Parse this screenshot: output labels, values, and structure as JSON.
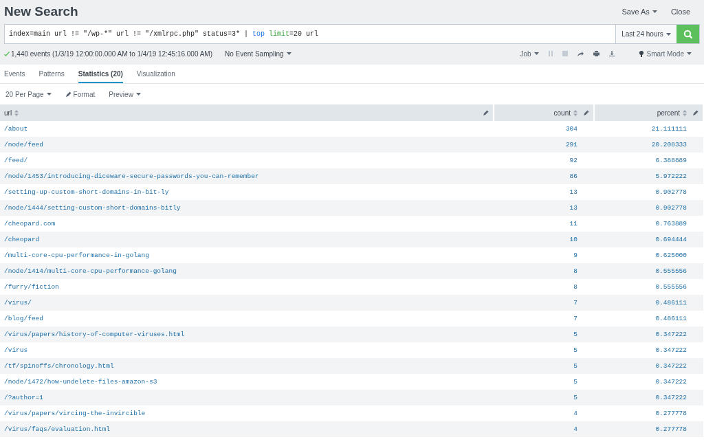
{
  "title": "New Search",
  "header_actions": [
    {
      "label": "Save As",
      "dropdown": true
    },
    {
      "label": "Close",
      "dropdown": false
    }
  ],
  "query": [
    {
      "text": "index=main url != \"/wp-*\" url != \"/xmlrpc.php\" status=3* | ",
      "kind": "plain"
    },
    {
      "text": "top ",
      "kind": "command"
    },
    {
      "text": "limit",
      "kind": "argument"
    },
    {
      "text": "=20 url",
      "kind": "plain"
    }
  ],
  "time_range": "Last 24 hours",
  "status": {
    "summary": "1,440 events (1/3/19 12:00:00.000 AM to 1/4/19 12:45:16.000 AM)",
    "sampling": "No Event Sampling",
    "job": "Job",
    "mode": "Smart Mode"
  },
  "tabs": [
    {
      "label": "Events",
      "selected": false
    },
    {
      "label": "Patterns",
      "selected": false
    },
    {
      "label": "Statistics (20)",
      "selected": true
    },
    {
      "label": "Visualization",
      "selected": false
    }
  ],
  "toolbar": [
    "20 Per Page",
    "Format",
    "Preview"
  ],
  "table": {
    "columns": [
      "url",
      "count",
      "percent"
    ],
    "rows": [
      [
        "/about",
        "304",
        "21.111111"
      ],
      [
        "/node/feed",
        "291",
        "20.208333"
      ],
      [
        "/feed/",
        "92",
        "6.388889"
      ],
      [
        "/node/1453/introducing-diceware-secure-passwords-you-can-remember",
        "86",
        "5.972222"
      ],
      [
        "/setting-up-custom-short-domains-in-bit-ly",
        "13",
        "0.902778"
      ],
      [
        "/node/1444/setting-custom-short-domains-bitly",
        "13",
        "0.902778"
      ],
      [
        "/cheopard.com",
        "11",
        "0.763889"
      ],
      [
        "/cheopard",
        "10",
        "0.694444"
      ],
      [
        "/multi-core-cpu-performance-in-golang",
        "9",
        "0.625000"
      ],
      [
        "/node/1414/multi-core-cpu-performance-golang",
        "8",
        "0.555556"
      ],
      [
        "/furry/fiction",
        "8",
        "0.555556"
      ],
      [
        "/virus/",
        "7",
        "0.486111"
      ],
      [
        "/blog/feed",
        "7",
        "0.486111"
      ],
      [
        "/virus/papers/history-of-computer-viruses.html",
        "5",
        "0.347222"
      ],
      [
        "/virus",
        "5",
        "0.347222"
      ],
      [
        "/tf/spinoffs/chronology.html",
        "5",
        "0.347222"
      ],
      [
        "/node/1472/how-undelete-files-amazon-s3",
        "5",
        "0.347222"
      ],
      [
        "/?author=1",
        "5",
        "0.347222"
      ],
      [
        "/virus/papers/vircing-the-invircible",
        "4",
        "0.277778"
      ],
      [
        "/virus/faqs/evaluation.html",
        "4",
        "0.277778"
      ]
    ]
  }
}
